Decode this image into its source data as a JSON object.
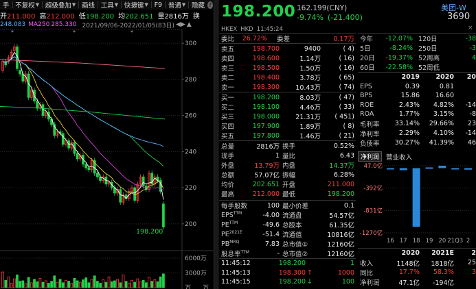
{
  "toolbar": {
    "items": [
      "手",
      "不复权",
      "超级叠加",
      "画线",
      "工具",
      "快捷键",
      "F9",
      "普通",
      "隐藏"
    ],
    "q_badge": "?"
  },
  "quote_line": {
    "open_label": "开",
    "open": "211.000",
    "high_label": "高",
    "high": "212.000",
    "low_label": "低",
    "low": "198.200",
    "avg_label": "均",
    "avg": "202.651",
    "vol_label": "量",
    "vol": "2816万",
    "turn_label": "换"
  },
  "ma_line": {
    "ma_val1": "248.083",
    "ma250_label": "MA250",
    "ma250": "285.330",
    "date_range": "2021/09/06-2022/01/05(83日)"
  },
  "price_axis": [
    "300",
    "280",
    "260",
    "240",
    "220",
    "200"
  ],
  "last_price_tag": "198.200",
  "vol_axis": [
    "6000万",
    "3000万",
    "万"
  ],
  "vol_marker": "万",
  "header": {
    "price": "198.200",
    "ref_price": "162.199(CNY)",
    "change": "-9.74%",
    "change_abs": "(-21.400)",
    "exchange": "HKEX",
    "currency": "HKD",
    "time": "11:45:24",
    "name": "美团-W",
    "code": "3690"
  },
  "weibi": {
    "label1": "委比",
    "val1": "26.72%",
    "label2": "委差",
    "val2": "0.17万"
  },
  "asks": [
    {
      "label": "卖五",
      "price": "198.700",
      "vol": "9400",
      "count": "( 4)"
    },
    {
      "label": "卖四",
      "price": "198.600",
      "vol": "1.14万",
      "count": "( 16)"
    },
    {
      "label": "卖三",
      "price": "198.500",
      "vol": "1.50万",
      "count": "( 16)"
    },
    {
      "label": "卖二",
      "price": "198.400",
      "vol": "3.78万",
      "count": "( 65)"
    },
    {
      "label": "卖一",
      "price": "198.300",
      "vol": "10.43万",
      "count": "( 74)"
    }
  ],
  "bids": [
    {
      "label": "买一",
      "price": "198.200",
      "vol": "8.03万",
      "count": "( 47)"
    },
    {
      "label": "买二",
      "price": "198.100",
      "vol": "4.46万",
      "count": "( 33)"
    },
    {
      "label": "买三",
      "price": "198.000",
      "vol": "21.31万",
      "count": "( 451)"
    },
    {
      "label": "买四",
      "price": "197.900",
      "vol": "1.89万",
      "count": "( 8)"
    },
    {
      "label": "买五",
      "price": "197.800",
      "vol": "1.46万",
      "count": "( 21)"
    }
  ],
  "stats": [
    {
      "l1": "总量",
      "v1": "2816万",
      "l2": "换手",
      "v2": "0.52%"
    },
    {
      "l1": "现手",
      "v1": "1",
      "l2": "量比",
      "v2": "6.43"
    },
    {
      "l1": "外盘",
      "v1": "13.79万",
      "l2": "内盘",
      "v2": "14.37万"
    },
    {
      "l1": "总额",
      "v1": "57.07亿",
      "l2": "振幅",
      "v2": "6.28%"
    },
    {
      "l1": "均价",
      "v1": "202.651",
      "l2": "开盘",
      "v2": "211.000"
    },
    {
      "l1": "最高",
      "v1": "212.000",
      "l2": "最低",
      "v2": "198.200"
    }
  ],
  "fundamentals": [
    {
      "l1": "每手股数",
      "v1": "100",
      "l2": "最小价差",
      "v2": "0.1"
    },
    {
      "l1": "EPS",
      "sup1": "TTM",
      "v1": "-4.00",
      "l2": "流通盘",
      "v2": "54.57亿"
    },
    {
      "l1": "PE",
      "sup1": "TTM",
      "v1": "-49.6",
      "l2": "总股本",
      "v2": "61.35亿"
    },
    {
      "l1": "PE",
      "sup1": "2021E",
      "v1": "-51.4",
      "l2": "流通值",
      "v2": "10816亿"
    },
    {
      "l1": "PB",
      "sup1": "MRQ",
      "v1": "7.83",
      "l2": "总市值①",
      "v2": "12160亿"
    },
    {
      "l1": "股息率",
      "sup1": "TTM",
      "v1": "-",
      "l2": "总市值②",
      "v2": "12160亿"
    }
  ],
  "ticks": [
    {
      "time": "11:45:12",
      "price": "198.200",
      "arrow": "",
      "vol": "1"
    },
    {
      "time": "11:45:13",
      "price": "198.300",
      "arrow": "↑",
      "vol": "1000"
    },
    {
      "time": "11:45:15",
      "price": "198.200",
      "arrow": "↓",
      "vol": "100"
    }
  ],
  "period_returns": [
    {
      "l1": "今年",
      "v1": "-12.07%",
      "l2": "120日",
      "v2": "-38"
    },
    {
      "l1": "5日",
      "v1": "-8.24%",
      "l2": "250日",
      "v2": "-3"
    },
    {
      "l1": "20日",
      "v1": "-19.37%",
      "l2": "52周高",
      "v2": "4"
    },
    {
      "l1": "60日",
      "v1": "-22.58%",
      "l2": "52周低",
      "v2": ""
    }
  ],
  "fin_table": {
    "years": [
      "2019",
      "2020",
      "20"
    ],
    "rows": [
      {
        "label": "EPS",
        "v2019": "0.39",
        "v2020": "0.81",
        "v3": ""
      },
      {
        "label": "BPS",
        "v2019": "15.86",
        "v2020": "16.60",
        "v3": ""
      },
      {
        "label": "ROE",
        "v2019": "2.43%",
        "v2020": "4.82%",
        "v3": "-14"
      },
      {
        "label": "ROA",
        "v2019": "1.77%",
        "v2020": "3.15%",
        "v3": "-8"
      },
      {
        "label": "毛利率",
        "v2019": "33.14%",
        "v2020": "29.66%",
        "v3": "23"
      },
      {
        "label": "净利率",
        "v2019": "2.29%",
        "v2020": "4.10%",
        "v3": "-14"
      },
      {
        "label": "负债率",
        "v2019": "30.27%",
        "v2020": "41.39%",
        "v3": "46"
      }
    ]
  },
  "profit_tabs": {
    "tab1": "净利润",
    "tab2": "营业收入"
  },
  "profit_chart": {
    "y_labels": [
      "47.0亿",
      "-392亿",
      "-831亿",
      "-1270亿"
    ],
    "x_labels": [
      "16",
      "17",
      "18",
      "19",
      "20",
      "21Q3",
      "2"
    ],
    "values": [
      -15,
      -40,
      -1150,
      14,
      47,
      -10,
      -30
    ]
  },
  "summary": {
    "years": [
      "2020",
      "2021E",
      "2"
    ],
    "rows": [
      {
        "label": "收入",
        "v1": "1148亿",
        "v2": "1818亿",
        "v3": "25"
      },
      {
        "label": "同比",
        "v1": "17.7%",
        "v2": "58.3%",
        "v3": "3"
      },
      {
        "label": "净利润",
        "v1": "47.1亿",
        "v2": "-194亿",
        "v3": ""
      }
    ]
  },
  "chart_data": {
    "type": "candlestick",
    "ylim": [
      195,
      305
    ],
    "closes": [
      290,
      288,
      292,
      295,
      298,
      286,
      283,
      279,
      283,
      270,
      274,
      268,
      264,
      266,
      260,
      262,
      258,
      255,
      249,
      251,
      250,
      244,
      246,
      242,
      245,
      239,
      236,
      238,
      233,
      231,
      230,
      235,
      228,
      226,
      224,
      226,
      222,
      223,
      220,
      217,
      219,
      212,
      216,
      214,
      218,
      220,
      213,
      222,
      226,
      221,
      219,
      228,
      222,
      226,
      224,
      218,
      198.2
    ],
    "opens": [
      285,
      290,
      290,
      292,
      296,
      298,
      285,
      283,
      279,
      283,
      270,
      274,
      268,
      264,
      266,
      260,
      262,
      258,
      255,
      249,
      251,
      250,
      244,
      246,
      242,
      245,
      239,
      236,
      238,
      233,
      231,
      230,
      235,
      228,
      226,
      224,
      226,
      222,
      223,
      220,
      217,
      219,
      212,
      216,
      214,
      218,
      220,
      213,
      222,
      226,
      221,
      219,
      228,
      222,
      226,
      224,
      211
    ],
    "volumes": [
      3200,
      1500,
      2200,
      900,
      1800,
      2600,
      1300,
      1400,
      800,
      2100,
      1000,
      1700,
      1200,
      1900,
      1100,
      1400,
      900,
      1300,
      2400,
      1100,
      1700,
      1000,
      1500,
      1300,
      900,
      1900,
      1400,
      1100,
      1600,
      2000,
      1000,
      1700,
      2400,
      1300,
      900,
      1600,
      1100,
      2200,
      1200,
      1400,
      1700,
      1000,
      2600,
      1300,
      900,
      1500,
      1100,
      1800,
      1200,
      1500,
      1000,
      2100,
      1300,
      1600,
      1200,
      2200,
      2816
    ]
  }
}
